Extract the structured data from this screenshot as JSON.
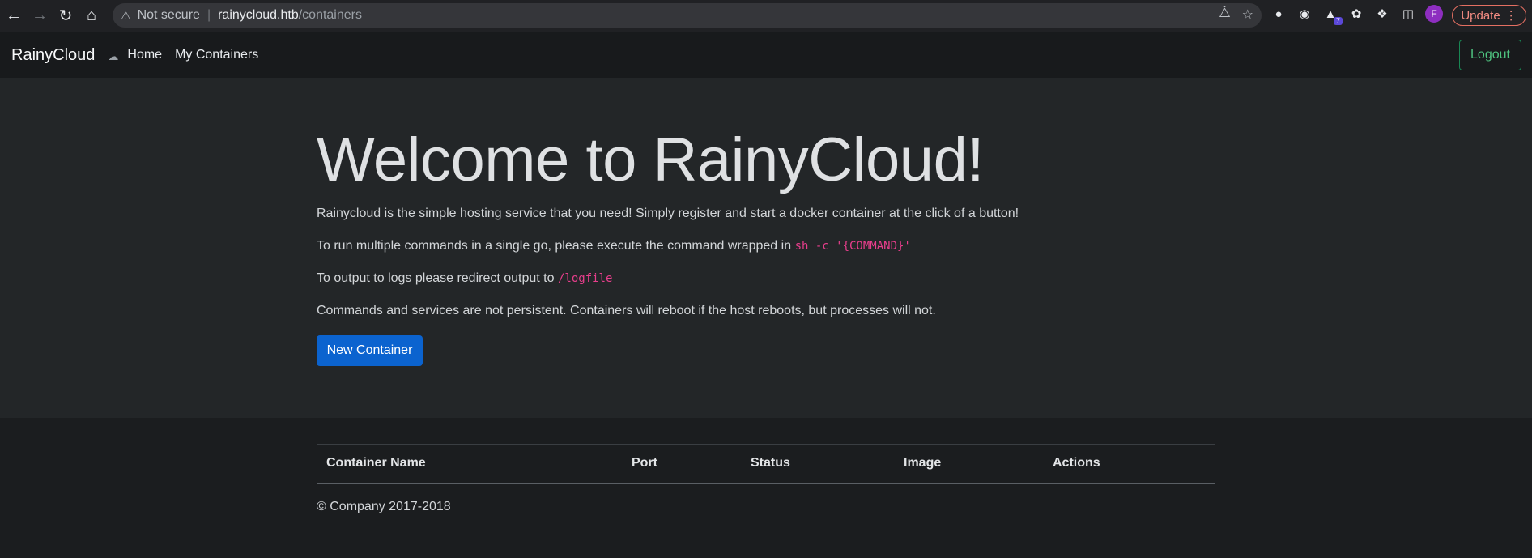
{
  "browser": {
    "security_label": "Not secure",
    "url_host": "rainycloud.htb",
    "url_path": "/containers",
    "extension_badge": "7",
    "profile_initial": "F",
    "update_label": "Update"
  },
  "navbar": {
    "brand": "RainyCloud",
    "links": [
      "Home",
      "My Containers"
    ],
    "logout_label": "Logout"
  },
  "jumbotron": {
    "title": "Welcome to RainyCloud!",
    "intro": "Rainycloud is the simple hosting service that you need! Simply register and start a docker container at the click of a button!",
    "multi_cmd_text": "To run multiple commands in a single go, please execute the command wrapped in",
    "multi_cmd_code": "sh -c '{COMMAND}'",
    "logs_text": "To output to logs please redirect output to",
    "logs_code": "/logfile",
    "persistence_note": "Commands and services are not persistent. Containers will reboot if the host reboots, but processes will not.",
    "new_container_label": "New Container"
  },
  "table": {
    "headers": [
      "Container Name",
      "Port",
      "Status",
      "Image",
      "Actions"
    ],
    "rows": []
  },
  "footer": {
    "text": "© Company 2017-2018"
  },
  "colors": {
    "accent_blue": "#0b63cf",
    "logout_green": "#198754",
    "code_pink": "#e83e8c"
  }
}
